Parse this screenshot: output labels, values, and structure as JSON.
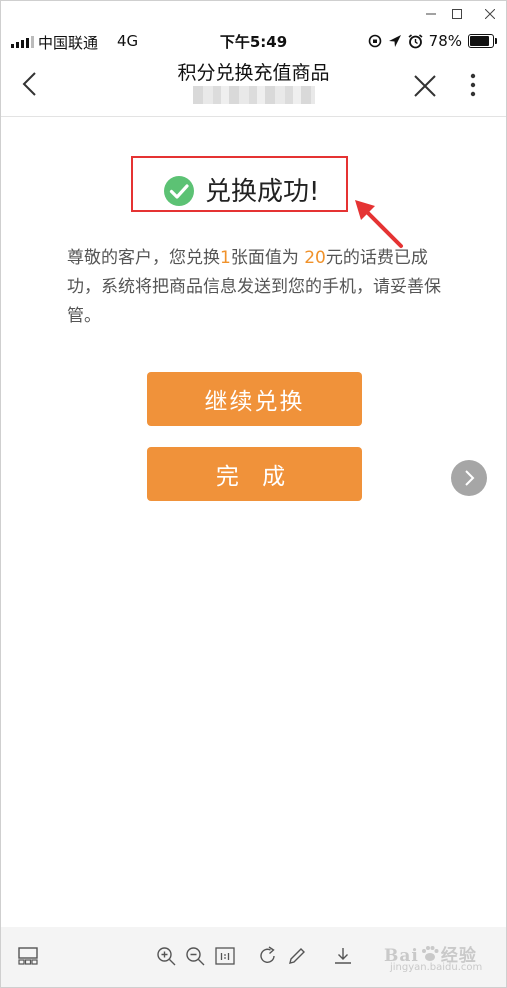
{
  "status_bar": {
    "carrier": "中国联通",
    "network": "4G",
    "time": "下午5:49",
    "battery": "78%",
    "battery_level": 0.78
  },
  "nav": {
    "title": "积分兑换充值商品"
  },
  "result": {
    "title": "兑换成功!",
    "msg_prefix": "尊敬的客户，您兑换",
    "msg_count": "1",
    "msg_middle": "张面值为 ",
    "msg_amount": "20",
    "msg_suffix": "元的话费已成功，系统将把商品信息发送到您的手机，请妥善保管。"
  },
  "actions": {
    "continue_label": "继续兑换",
    "done_label": "完 成"
  },
  "watermark": {
    "brand": "Bai",
    "suffix": "经验",
    "sub": "jingyan.baidu.com"
  },
  "colors": {
    "accent": "#f0923a",
    "highlight": "#f0922b",
    "success": "#5cc274",
    "annotation": "#e53333"
  }
}
